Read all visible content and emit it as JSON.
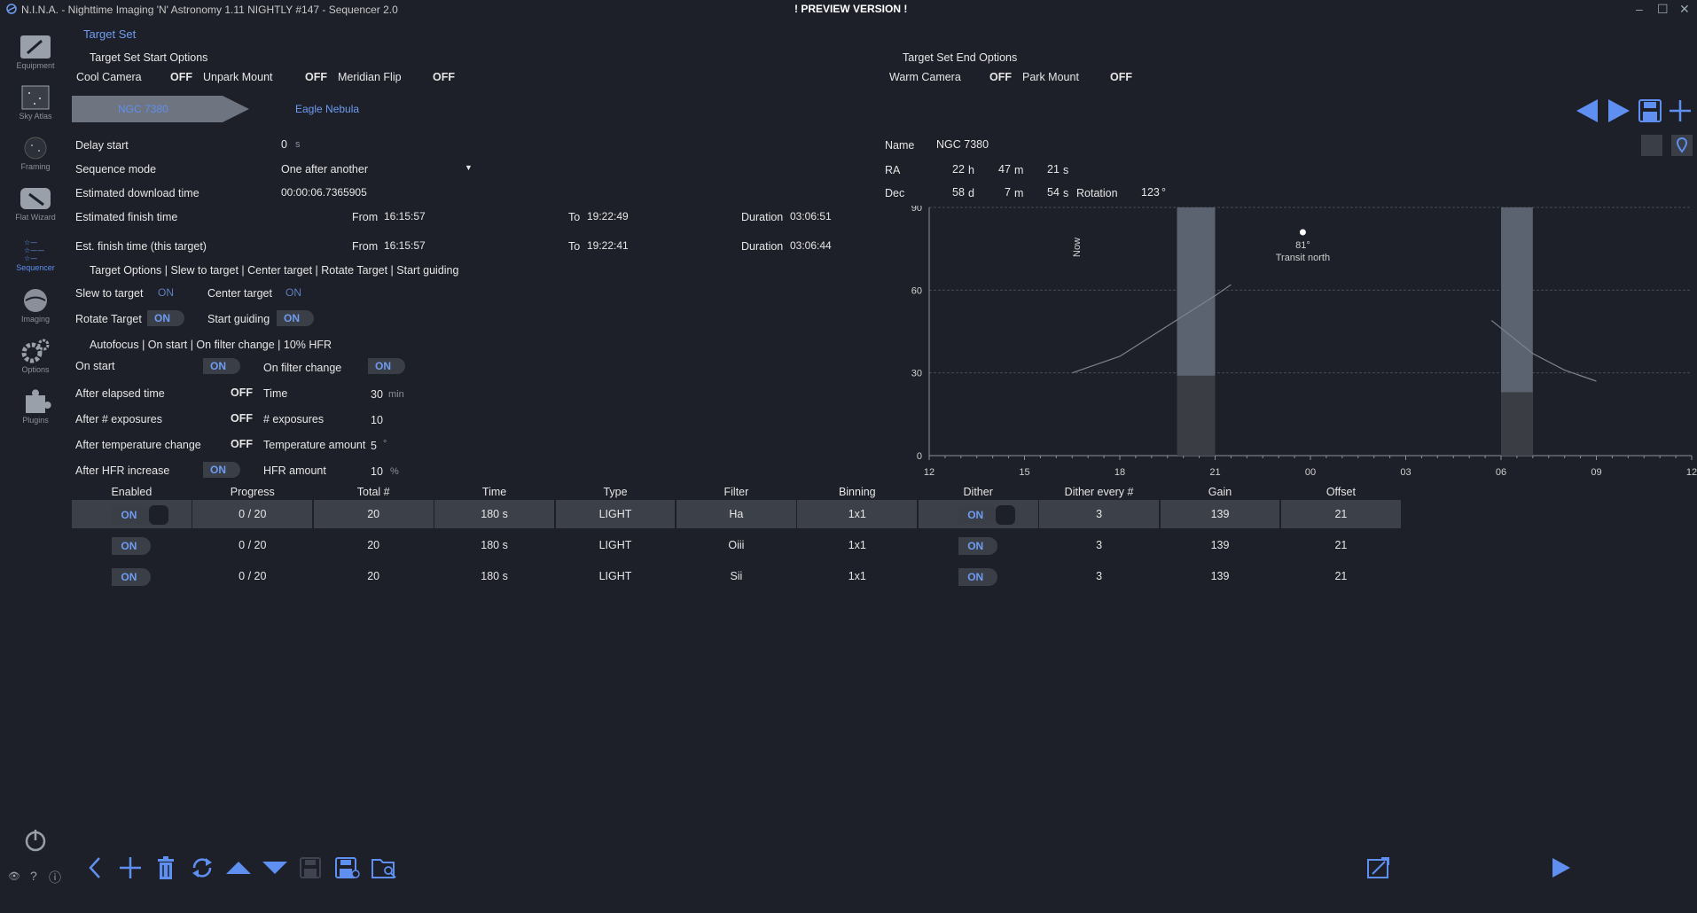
{
  "window": {
    "title": "N.I.N.A. - Nighttime Imaging 'N' Astronomy 1.11 NIGHTLY #147  -  Sequencer 2.0",
    "banner": "! PREVIEW VERSION !"
  },
  "sidebar": {
    "items": [
      {
        "label": "Equipment"
      },
      {
        "label": "Sky Atlas"
      },
      {
        "label": "Framing"
      },
      {
        "label": "Flat Wizard"
      },
      {
        "label": "Sequencer"
      },
      {
        "label": "Imaging"
      },
      {
        "label": "Options"
      },
      {
        "label": "Plugins"
      }
    ]
  },
  "header": {
    "title": "Target Set"
  },
  "start_options": {
    "title": "Target Set Start Options",
    "cool_camera": "Cool Camera",
    "cool_camera_value": "OFF",
    "unpark_mount": "Unpark Mount",
    "unpark_mount_value": "OFF",
    "meridian_flip": "Meridian Flip",
    "meridian_flip_value": "OFF"
  },
  "end_options": {
    "title": "Target Set End Options",
    "warm_camera": "Warm Camera",
    "warm_camera_value": "OFF",
    "park_mount": "Park Mount",
    "park_mount_value": "OFF"
  },
  "targets": {
    "active": "NGC 7380",
    "other": "Eagle Nebula"
  },
  "settings": {
    "delay_start_label": "Delay start",
    "delay_start_value": "0",
    "delay_start_unit": "s",
    "sequence_mode_label": "Sequence mode",
    "sequence_mode_value": "One after another",
    "est_download_label": "Estimated download time",
    "est_download_value": "00:00:06.7365905",
    "est_finish_label": "Estimated finish time",
    "est_finish_target_label": "Est. finish time (this target)",
    "from_label": "From",
    "to_label": "To",
    "duration_label": "Duration",
    "finish_from": "16:15:57",
    "finish_to": "19:22:49",
    "finish_duration": "03:06:51",
    "target_from": "16:15:57",
    "target_to": "19:22:41",
    "target_duration": "03:06:44"
  },
  "target_options": {
    "summary": "Target Options | Slew to target | Center target | Rotate Target | Start guiding",
    "slew_label": "Slew to target",
    "slew_value": "ON",
    "center_label": "Center target",
    "center_value": "ON",
    "rotate_label": "Rotate Target",
    "rotate_value": "ON",
    "guiding_label": "Start guiding",
    "guiding_value": "ON"
  },
  "autofocus": {
    "summary": "Autofocus | On start | On filter change | 10% HFR",
    "on_start_label": "On start",
    "on_start_value": "ON",
    "on_filter_label": "On filter change",
    "on_filter_value": "ON",
    "elapsed_label": "After elapsed time",
    "elapsed_value": "OFF",
    "time_label": "Time",
    "time_value": "30",
    "time_unit": "min",
    "exposures_label": "After # exposures",
    "exposures_value": "OFF",
    "num_exposures_label": "# exposures",
    "num_exposures_value": "10",
    "temp_label": "After temperature change",
    "temp_value": "OFF",
    "temp_amount_label": "Temperature amount",
    "temp_amount_value": "5",
    "temp_unit": "°",
    "hfr_label": "After HFR increase",
    "hfr_value": "ON",
    "hfr_amount_label": "HFR amount",
    "hfr_amount_value": "10",
    "hfr_unit": "%"
  },
  "target_info": {
    "name_label": "Name",
    "name_value": "NGC 7380",
    "ra_label": "RA",
    "ra_h": "22",
    "ra_h_unit": "h",
    "ra_m": "47",
    "ra_m_unit": "m",
    "ra_s": "21",
    "ra_s_unit": "s",
    "dec_label": "Dec",
    "dec_d": "58",
    "dec_d_unit": "d",
    "dec_m": "7",
    "dec_m_unit": "m",
    "dec_s": "54",
    "dec_s_unit": "s",
    "rotation_label": "Rotation",
    "rotation_value": "123",
    "rotation_unit": "°"
  },
  "chart_data": {
    "type": "line",
    "title": "",
    "xlabel": "",
    "ylabel": "",
    "x_ticks": [
      "12",
      "15",
      "18",
      "21",
      "00",
      "03",
      "06",
      "09",
      "12"
    ],
    "y_ticks": [
      "0",
      "30",
      "60",
      "90"
    ],
    "ylim": [
      0,
      90
    ],
    "now_label": "Now",
    "transit_label": "Transit north",
    "transit_alt": "81°",
    "series": [
      {
        "points": [
          [
            16.5,
            30
          ],
          [
            18.0,
            36
          ],
          [
            19.5,
            47
          ],
          [
            21.0,
            58
          ],
          [
            21.5,
            62
          ]
        ]
      },
      {
        "points": [
          [
            5.7,
            49
          ],
          [
            7.0,
            37
          ],
          [
            8.0,
            31
          ],
          [
            9.0,
            27
          ]
        ]
      }
    ],
    "night_bands": [
      [
        19.8,
        21.0
      ],
      [
        6.0,
        7.0
      ]
    ],
    "dark_fill_levels": [
      29,
      23
    ]
  },
  "table": {
    "columns": [
      "Enabled",
      "Progress",
      "Total #",
      "Time",
      "Type",
      "Filter",
      "Binning",
      "Dither",
      "Dither every #",
      "Gain",
      "Offset"
    ],
    "rows": [
      {
        "enabled": "ON",
        "progress": "0 / 20",
        "total": "20",
        "time": "180 s",
        "type": "LIGHT",
        "filter": "Ha",
        "binning": "1x1",
        "dither": "ON",
        "dither_every": "3",
        "gain": "139",
        "offset": "21"
      },
      {
        "enabled": "ON",
        "progress": "0 / 20",
        "total": "20",
        "time": "180 s",
        "type": "LIGHT",
        "filter": "Oiii",
        "binning": "1x1",
        "dither": "ON",
        "dither_every": "3",
        "gain": "139",
        "offset": "21"
      },
      {
        "enabled": "ON",
        "progress": "0 / 20",
        "total": "20",
        "time": "180 s",
        "type": "LIGHT",
        "filter": "Sii",
        "binning": "1x1",
        "dither": "ON",
        "dither_every": "3",
        "gain": "139",
        "offset": "21"
      }
    ]
  },
  "colors": {
    "accent": "#5f8ff0",
    "background": "#1d2028",
    "row_selected": "#3c4049"
  }
}
